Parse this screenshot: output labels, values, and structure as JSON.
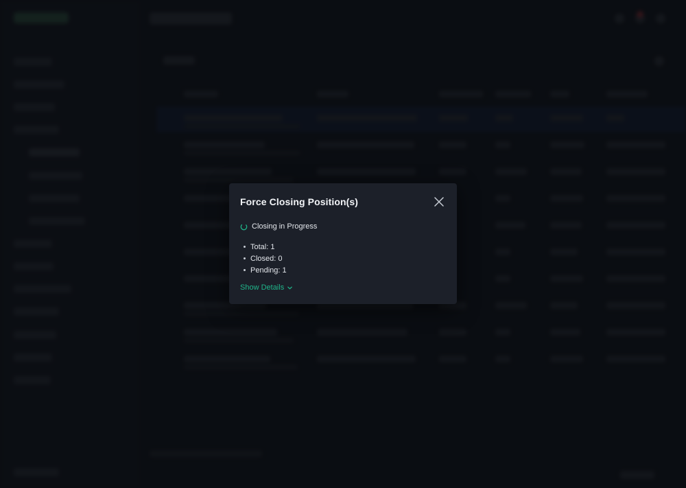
{
  "modal": {
    "title": "Force Closing Position(s)",
    "status": "Closing in Progress",
    "stats": [
      "Total: 1",
      "Closed: 0",
      "Pending: 1"
    ],
    "details_link": "Show Details"
  },
  "icons": {
    "close": "close-icon",
    "spinner": "spinner-icon",
    "expand": "chevron-down-icon"
  },
  "colors": {
    "accent": "#1fb58a",
    "modal_bg": "#1c2029",
    "page_bg": "#12161d"
  }
}
